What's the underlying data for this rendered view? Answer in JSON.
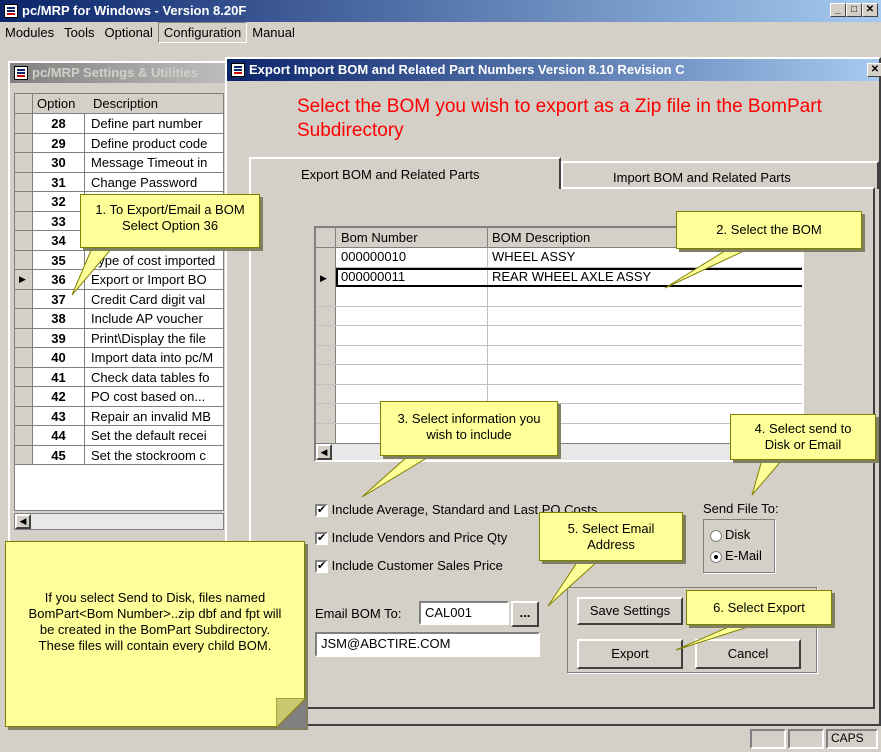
{
  "main_window": {
    "title": "pc/MRP for Windows - Version 8.20F"
  },
  "menu": [
    "Modules",
    "Tools",
    "Optional",
    "Configuration",
    "Manual"
  ],
  "settings_window": {
    "title": "pc/MRP Settings & Utilities",
    "col_option": "Option",
    "col_description": "Description",
    "rows": [
      {
        "option": "28",
        "desc": "Define part number"
      },
      {
        "option": "29",
        "desc": "Define product code"
      },
      {
        "option": "30",
        "desc": "Message Timeout in"
      },
      {
        "option": "31",
        "desc": "Change Password"
      },
      {
        "option": "32",
        "desc": ""
      },
      {
        "option": "33",
        "desc": ""
      },
      {
        "option": "34",
        "desc": ""
      },
      {
        "option": "35",
        "desc": "Type of cost imported"
      },
      {
        "option": "36",
        "desc": "Export or Import BO"
      },
      {
        "option": "37",
        "desc": "Credit Card digit val"
      },
      {
        "option": "38",
        "desc": "Include AP voucher"
      },
      {
        "option": "39",
        "desc": "Print\\Display the file"
      },
      {
        "option": "40",
        "desc": "Import data into pc/M"
      },
      {
        "option": "41",
        "desc": "Check data tables fo"
      },
      {
        "option": "42",
        "desc": "PO cost based on..."
      },
      {
        "option": "43",
        "desc": "Repair an invalid MB"
      },
      {
        "option": "44",
        "desc": "Set the default recei"
      },
      {
        "option": "45",
        "desc": "Set the stockroom c"
      }
    ]
  },
  "dialog": {
    "title": "Export Import BOM and Related Part Numbers Version 8.10 Revision C",
    "heading": "Select the BOM you wish to export as a Zip file in the BomPart Subdirectory",
    "tabs": [
      "Export BOM and Related Parts",
      "Import BOM and Related Parts"
    ],
    "grid": {
      "col_number": "Bom Number",
      "col_description": "BOM Description",
      "rows": [
        {
          "number": "000000010",
          "description": "WHEEL ASSY"
        },
        {
          "number": "000000011",
          "description": "REAR WHEEL AXLE ASSY"
        }
      ]
    },
    "checks": [
      "Include Average, Standard and Last PO Costs",
      "Include Vendors and Price Qty",
      "Include Customer Sales Price"
    ],
    "send_file_to": {
      "label": "Send File To:",
      "options": [
        "Disk",
        "E-Mail"
      ],
      "selected": "E-Mail"
    },
    "email_label": "Email BOM To:",
    "email_code": "CAL001",
    "ellipsis": "...",
    "email_address": "JSM@ABCTIRE.COM",
    "buttons": {
      "save": "Save Settings",
      "export": "Export",
      "cancel": "Cancel"
    }
  },
  "callouts": {
    "c1": "1.  To Export/Email a BOM Select Option 36",
    "c2": "2. Select the BOM",
    "c3": "3. Select information you wish to include",
    "c4": "4. Select send to Disk or Email",
    "c5": "5. Select Email Address",
    "c6": "6. Select Export",
    "note": "If you select Send to Disk, files named BomPart<Bom Number>..zip dbf and fpt will be created in the BomPart Subdirectory.   These files will contain every child BOM."
  },
  "status": {
    "caps": "CAPS"
  },
  "colors": {
    "heading_red": "#ff0000",
    "callout_yellow": "#ffff99",
    "title_blue": "#0a246a"
  }
}
